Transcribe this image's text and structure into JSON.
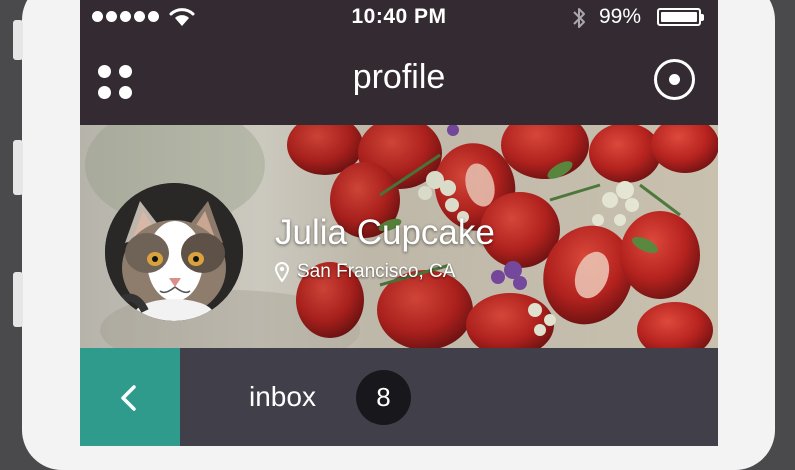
{
  "status_bar": {
    "time": "10:40 PM",
    "battery_percent": "99%",
    "battery_level": 0.99,
    "signal_dots": 5,
    "wifi_icon": "wifi-icon",
    "bluetooth_icon": "bluetooth-icon"
  },
  "navbar": {
    "title": "profile",
    "menu_icon": "grid-dots-icon",
    "action_icon": "target-circle-icon"
  },
  "profile": {
    "name": "Julia Cupcake",
    "location": "San Francisco, CA",
    "location_icon": "map-pin-icon",
    "avatar": "cat-photo-avatar",
    "cover": "strawberries-cover-photo"
  },
  "inbox": {
    "label": "inbox",
    "count": "8",
    "back_icon": "chevron-left-icon"
  },
  "colors": {
    "navbar_bg": "#332b31",
    "inbox_bar_bg": "#403f4a",
    "accent_teal": "#2f9b8d",
    "badge_bg": "#18171b"
  }
}
